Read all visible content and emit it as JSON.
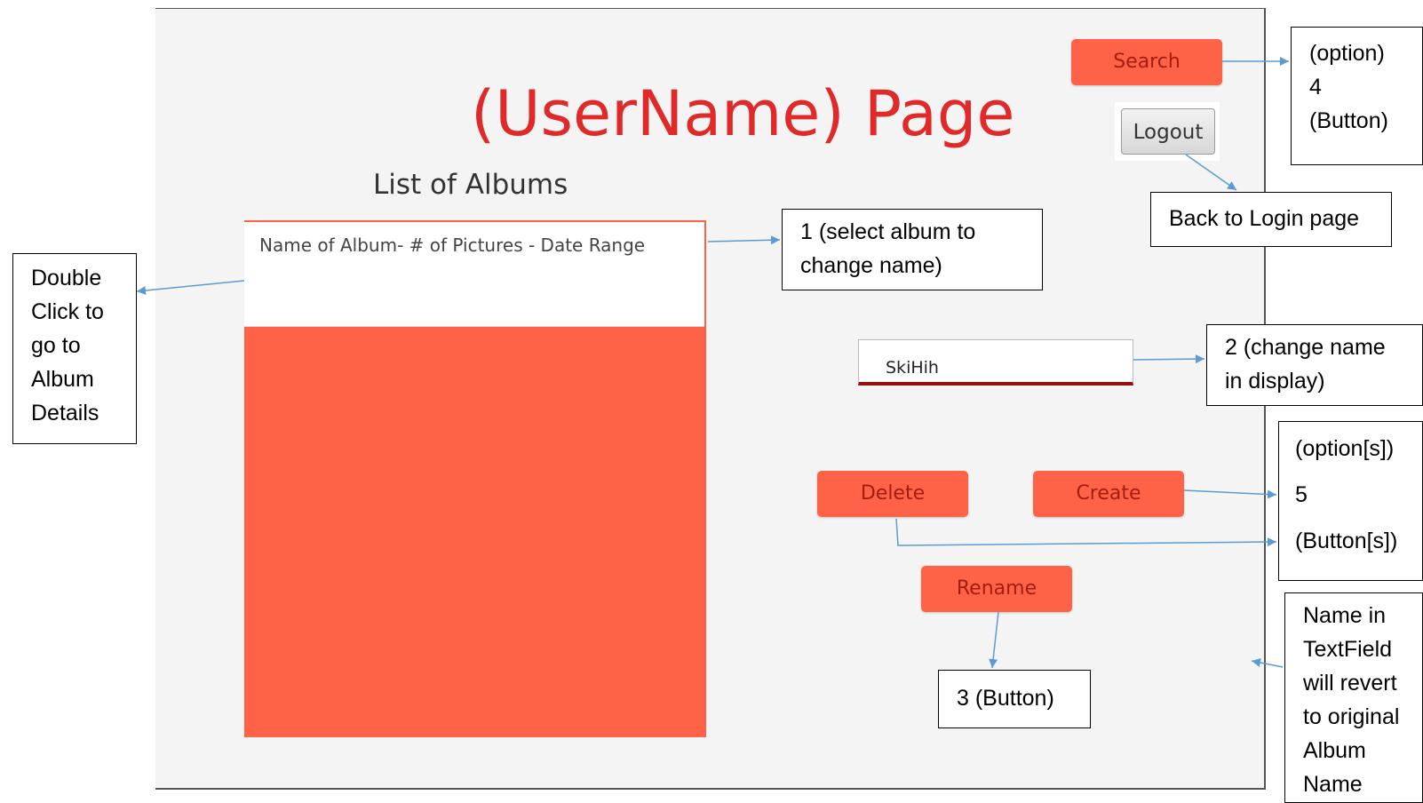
{
  "window": {
    "title": "(UserName) Page",
    "list_heading": "List of Albums",
    "album_item": "Name of Album- # of Pictures - Date Range",
    "name_field_value": "SkiHih",
    "buttons": {
      "search": "Search",
      "logout": "Logout",
      "delete": "Delete",
      "create": "Create",
      "rename": "Rename"
    }
  },
  "callouts": {
    "double_click": [
      "Double",
      "Click to",
      "go to",
      "Album",
      "Details"
    ],
    "select_album": [
      "1 (select album to",
      "change name)"
    ],
    "search_option": [
      "(option)",
      "4",
      "(Button)"
    ],
    "back_to_login": "Back to Login page",
    "change_name": [
      "2 (change name",
      "in display)"
    ],
    "options_5": [
      "(option[s])",
      "5",
      "(Button[s])"
    ],
    "rename_button": "3 (Button)",
    "revert_name": [
      "Name in",
      "TextField",
      "will revert",
      "to original",
      "Album",
      "Name"
    ]
  },
  "colors": {
    "accent": "#ff6347",
    "title_red": "#e02a2a",
    "button_text": "#a41e10",
    "arrow": "#5b9bd5"
  }
}
